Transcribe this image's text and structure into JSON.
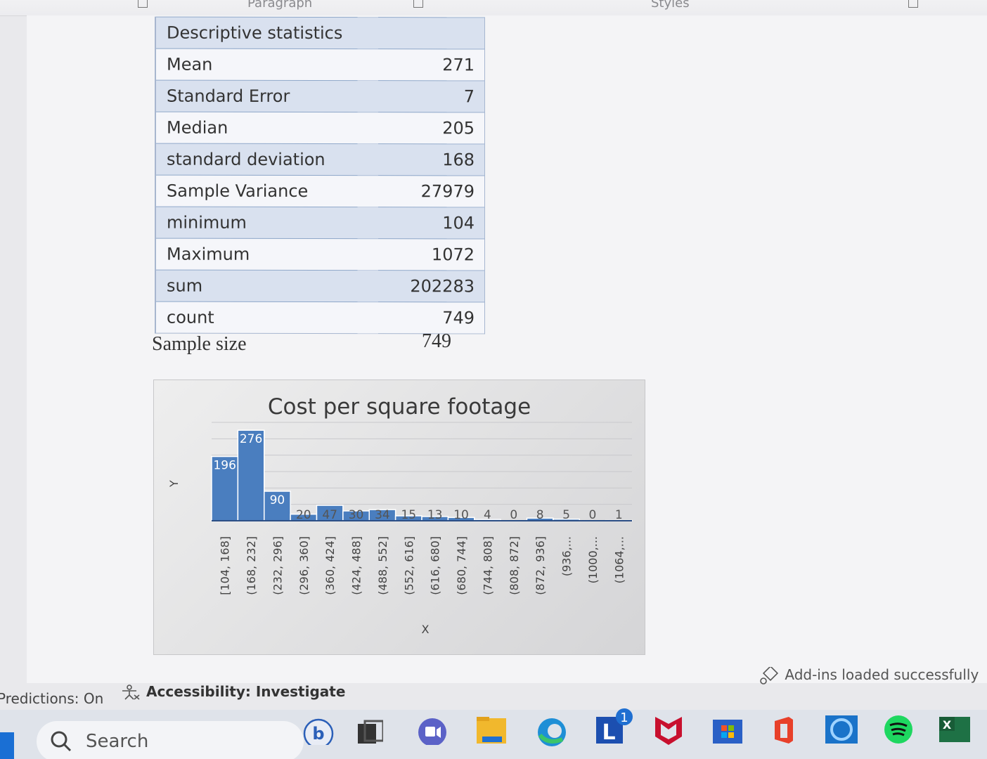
{
  "ribbon": {
    "groups": [
      "Paragraph",
      "Styles"
    ]
  },
  "stats_table": {
    "title": "Descriptive statistics",
    "rows": [
      {
        "label": "Mean",
        "value": "271"
      },
      {
        "label": "Standard Error",
        "value": "7"
      },
      {
        "label": "Median",
        "value": "205"
      },
      {
        "label": "standard deviation",
        "value": "168"
      },
      {
        "label": "Sample Variance",
        "value": "27979"
      },
      {
        "label": "minimum",
        "value": "104"
      },
      {
        "label": "Maximum",
        "value": "1072"
      },
      {
        "label": "sum",
        "value": "202283"
      },
      {
        "label": "count",
        "value": "749"
      }
    ]
  },
  "sample": {
    "label": "Sample size",
    "value": "749"
  },
  "chart_data": {
    "type": "bar",
    "title": "Cost per square footage",
    "ylabel": "Y",
    "xlabel": "X",
    "categories": [
      "[104, 168]",
      "(168, 232]",
      "(232, 296]",
      "(296, 360]",
      "(360, 424]",
      "(424, 488]",
      "(488, 552]",
      "(552, 616]",
      "(616, 680]",
      "(680, 744]",
      "(744, 808]",
      "(808, 872]",
      "(872, 936]",
      "(936,...",
      "(1000,...",
      "(1064,..."
    ],
    "values": [
      196,
      276,
      90,
      20,
      47,
      30,
      34,
      15,
      13,
      10,
      4,
      0,
      8,
      5,
      0,
      1
    ],
    "ylim": [
      0,
      300
    ],
    "bar_color": "#4a7ebf",
    "grid": true
  },
  "status": {
    "predictions": "Predictions: On",
    "accessibility": "Accessibility: Investigate",
    "addins": "Add-ins loaded successfully"
  },
  "taskbar": {
    "search_label": "Search",
    "icons": [
      "bing-icon",
      "taskview-icon",
      "teams-icon",
      "file-explorer-icon",
      "edge-icon",
      "l-app-icon",
      "mcafee-icon",
      "store-icon",
      "office-icon",
      "cortana-icon",
      "spotify-icon",
      "excel-icon"
    ],
    "badge": "1"
  }
}
